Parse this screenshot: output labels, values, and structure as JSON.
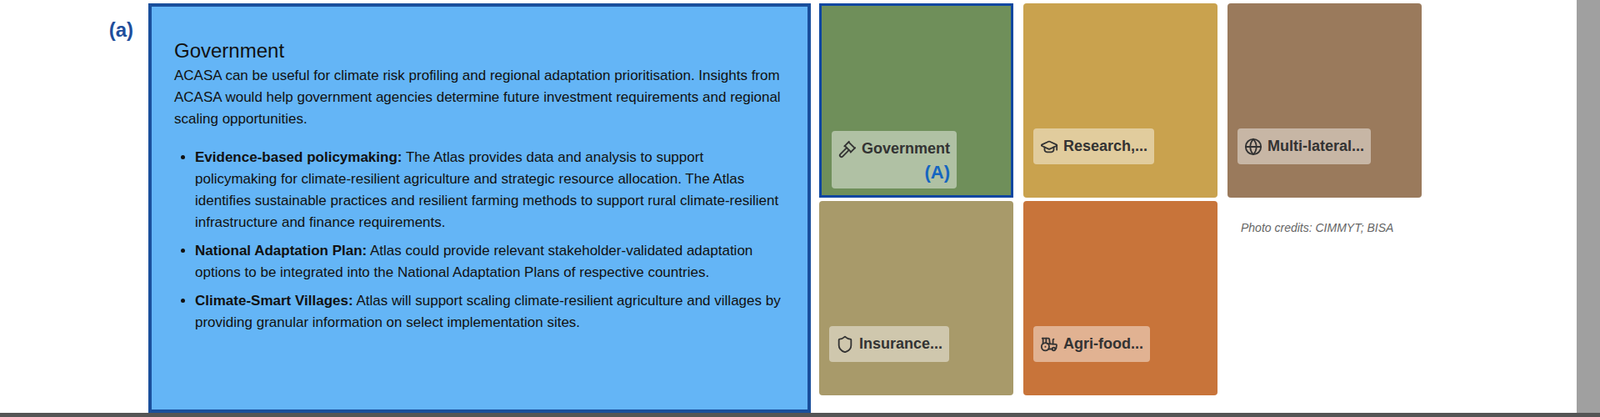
{
  "figure_label": "(a)",
  "panel": {
    "title": "Government",
    "intro": "ACASA can be useful for climate risk profiling and regional adaptation prioritisation. Insights from ACASA would help government agencies determine future investment requirements and regional scaling opportunities.",
    "bullets": [
      {
        "term": "Evidence-based policymaking:",
        "text": "The Atlas provides data and analysis to support policymaking for climate-resilient agriculture and strategic resource allocation. The Atlas identifies sustainable practices and resilient farming methods to support rural climate-resilient infrastructure and finance requirements."
      },
      {
        "term": "National Adaptation Plan:",
        "text": "Atlas could provide relevant stakeholder-validated adaptation options to be integrated into the National Adaptation Plans of respective countries."
      },
      {
        "term": "Climate-Smart Villages:",
        "text": "Atlas will support scaling climate-resilient agriculture and villages by providing granular information on select implementation sites."
      }
    ]
  },
  "tiles": [
    {
      "label": "Government",
      "selected": true,
      "marker": "(A)",
      "kind": "gavel",
      "color": "#6f8f5a"
    },
    {
      "label": "Research,...",
      "selected": false,
      "marker": "",
      "kind": "cap",
      "color": "#c9a24e"
    },
    {
      "label": "Multi-lateral...",
      "selected": false,
      "marker": "",
      "kind": "globe",
      "color": "#9a7a5c"
    },
    {
      "label": "Insurance...",
      "selected": false,
      "marker": "",
      "kind": "shield",
      "color": "#a89a6a"
    },
    {
      "label": "Agri-food...",
      "selected": false,
      "marker": "",
      "kind": "tractor",
      "color": "#c8743a"
    }
  ],
  "credits": "Photo credits: CIMMYT; BISA"
}
